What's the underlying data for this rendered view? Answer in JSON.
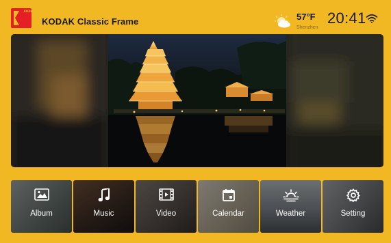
{
  "header": {
    "logo_letters": "KODAK",
    "title": "KODAK Classic Frame",
    "temperature": "57°F",
    "city": "Shenzhen",
    "time": "20:41",
    "weather_icon": "partly-sunny-icon",
    "wifi_icon": "wifi-icon"
  },
  "menu": [
    {
      "id": "album",
      "label": "Album",
      "icon": "image-icon"
    },
    {
      "id": "music",
      "label": "Music",
      "icon": "music-note-icon"
    },
    {
      "id": "video",
      "label": "Video",
      "icon": "film-icon"
    },
    {
      "id": "calendar",
      "label": "Calendar",
      "icon": "calendar-icon"
    },
    {
      "id": "weather",
      "label": "Weather",
      "icon": "sunrise-icon"
    },
    {
      "id": "setting",
      "label": "Setting",
      "icon": "gear-icon"
    }
  ],
  "colors": {
    "background": "#f2b823",
    "logo_red": "#e41f26",
    "text_dark": "#1a1a1a"
  }
}
